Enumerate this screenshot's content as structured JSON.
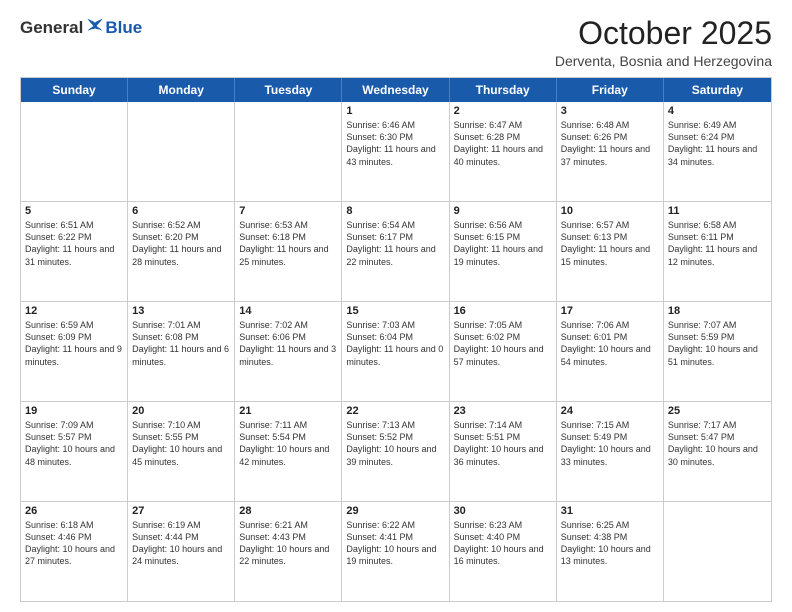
{
  "header": {
    "logo_general": "General",
    "logo_blue": "Blue",
    "month_title": "October 2025",
    "location": "Derventa, Bosnia and Herzegovina"
  },
  "calendar": {
    "days_of_week": [
      "Sunday",
      "Monday",
      "Tuesday",
      "Wednesday",
      "Thursday",
      "Friday",
      "Saturday"
    ],
    "weeks": [
      [
        {
          "day": "",
          "text": ""
        },
        {
          "day": "",
          "text": ""
        },
        {
          "day": "",
          "text": ""
        },
        {
          "day": "1",
          "text": "Sunrise: 6:46 AM\nSunset: 6:30 PM\nDaylight: 11 hours and 43 minutes."
        },
        {
          "day": "2",
          "text": "Sunrise: 6:47 AM\nSunset: 6:28 PM\nDaylight: 11 hours and 40 minutes."
        },
        {
          "day": "3",
          "text": "Sunrise: 6:48 AM\nSunset: 6:26 PM\nDaylight: 11 hours and 37 minutes."
        },
        {
          "day": "4",
          "text": "Sunrise: 6:49 AM\nSunset: 6:24 PM\nDaylight: 11 hours and 34 minutes."
        }
      ],
      [
        {
          "day": "5",
          "text": "Sunrise: 6:51 AM\nSunset: 6:22 PM\nDaylight: 11 hours and 31 minutes."
        },
        {
          "day": "6",
          "text": "Sunrise: 6:52 AM\nSunset: 6:20 PM\nDaylight: 11 hours and 28 minutes."
        },
        {
          "day": "7",
          "text": "Sunrise: 6:53 AM\nSunset: 6:18 PM\nDaylight: 11 hours and 25 minutes."
        },
        {
          "day": "8",
          "text": "Sunrise: 6:54 AM\nSunset: 6:17 PM\nDaylight: 11 hours and 22 minutes."
        },
        {
          "day": "9",
          "text": "Sunrise: 6:56 AM\nSunset: 6:15 PM\nDaylight: 11 hours and 19 minutes."
        },
        {
          "day": "10",
          "text": "Sunrise: 6:57 AM\nSunset: 6:13 PM\nDaylight: 11 hours and 15 minutes."
        },
        {
          "day": "11",
          "text": "Sunrise: 6:58 AM\nSunset: 6:11 PM\nDaylight: 11 hours and 12 minutes."
        }
      ],
      [
        {
          "day": "12",
          "text": "Sunrise: 6:59 AM\nSunset: 6:09 PM\nDaylight: 11 hours and 9 minutes."
        },
        {
          "day": "13",
          "text": "Sunrise: 7:01 AM\nSunset: 6:08 PM\nDaylight: 11 hours and 6 minutes."
        },
        {
          "day": "14",
          "text": "Sunrise: 7:02 AM\nSunset: 6:06 PM\nDaylight: 11 hours and 3 minutes."
        },
        {
          "day": "15",
          "text": "Sunrise: 7:03 AM\nSunset: 6:04 PM\nDaylight: 11 hours and 0 minutes."
        },
        {
          "day": "16",
          "text": "Sunrise: 7:05 AM\nSunset: 6:02 PM\nDaylight: 10 hours and 57 minutes."
        },
        {
          "day": "17",
          "text": "Sunrise: 7:06 AM\nSunset: 6:01 PM\nDaylight: 10 hours and 54 minutes."
        },
        {
          "day": "18",
          "text": "Sunrise: 7:07 AM\nSunset: 5:59 PM\nDaylight: 10 hours and 51 minutes."
        }
      ],
      [
        {
          "day": "19",
          "text": "Sunrise: 7:09 AM\nSunset: 5:57 PM\nDaylight: 10 hours and 48 minutes."
        },
        {
          "day": "20",
          "text": "Sunrise: 7:10 AM\nSunset: 5:55 PM\nDaylight: 10 hours and 45 minutes."
        },
        {
          "day": "21",
          "text": "Sunrise: 7:11 AM\nSunset: 5:54 PM\nDaylight: 10 hours and 42 minutes."
        },
        {
          "day": "22",
          "text": "Sunrise: 7:13 AM\nSunset: 5:52 PM\nDaylight: 10 hours and 39 minutes."
        },
        {
          "day": "23",
          "text": "Sunrise: 7:14 AM\nSunset: 5:51 PM\nDaylight: 10 hours and 36 minutes."
        },
        {
          "day": "24",
          "text": "Sunrise: 7:15 AM\nSunset: 5:49 PM\nDaylight: 10 hours and 33 minutes."
        },
        {
          "day": "25",
          "text": "Sunrise: 7:17 AM\nSunset: 5:47 PM\nDaylight: 10 hours and 30 minutes."
        }
      ],
      [
        {
          "day": "26",
          "text": "Sunrise: 6:18 AM\nSunset: 4:46 PM\nDaylight: 10 hours and 27 minutes."
        },
        {
          "day": "27",
          "text": "Sunrise: 6:19 AM\nSunset: 4:44 PM\nDaylight: 10 hours and 24 minutes."
        },
        {
          "day": "28",
          "text": "Sunrise: 6:21 AM\nSunset: 4:43 PM\nDaylight: 10 hours and 22 minutes."
        },
        {
          "day": "29",
          "text": "Sunrise: 6:22 AM\nSunset: 4:41 PM\nDaylight: 10 hours and 19 minutes."
        },
        {
          "day": "30",
          "text": "Sunrise: 6:23 AM\nSunset: 4:40 PM\nDaylight: 10 hours and 16 minutes."
        },
        {
          "day": "31",
          "text": "Sunrise: 6:25 AM\nSunset: 4:38 PM\nDaylight: 10 hours and 13 minutes."
        },
        {
          "day": "",
          "text": ""
        }
      ]
    ]
  }
}
